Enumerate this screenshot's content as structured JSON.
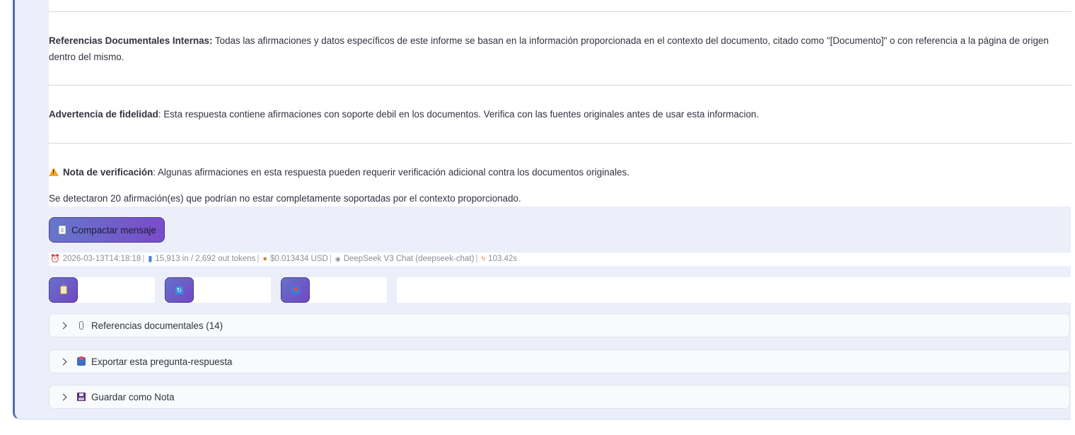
{
  "paragraphs": {
    "refs_title": "Referencias Documentales Internas:",
    "refs_body": " Todas las afirmaciones y datos específicos de este informe se basan en la información proporcionada en el contexto del documento, citado como \"[Documento]\" o con referencia a la página de origen dentro del mismo.",
    "fidelity_title": "Advertencia de fidelidad",
    "fidelity_body": ": Esta respuesta contiene afirmaciones con soporte debil en los documentos. Verifica con las fuentes originales antes de usar esta informacion.",
    "verif_title": "Nota de verificación",
    "verif_body": ": Algunas afirmaciones en esta respuesta pueden requerir verificación adicional contra los documentos originales.",
    "detected": "Se detectaron 20 afirmación(es) que podrían no estar completamente soportadas por el contexto proporcionado."
  },
  "compact_button": {
    "label": "Compactar mensaje",
    "icon": "document-icon"
  },
  "meta": {
    "timestamp": "2026-03-13T14:18:18",
    "tokens": "15,913 in / 2,692 out tokens",
    "cost": "$0.013434 USD",
    "model": "DeepSeek V3 Chat (deepseek-chat)",
    "duration": "103.42s",
    "separator": "|"
  },
  "actions": [
    {
      "icon": "clipboard-icon"
    },
    {
      "icon": "refresh-icon"
    },
    {
      "icon": "inbox-icon"
    }
  ],
  "expanders": {
    "references": {
      "label": "Referencias documentales (14)",
      "icon": "paperclip-icon"
    },
    "export": {
      "label": "Exportar esta pregunta-respuesta",
      "icon": "export-icon"
    },
    "note": {
      "label": "Guardar como Nota",
      "icon": "floppy-disk-icon"
    }
  },
  "colors": {
    "accent_left_border": "#4f6bb0",
    "button_gradient_start": "#6577c9",
    "button_gradient_end": "#7a4bc9",
    "panel_bg": "#eceef9"
  }
}
